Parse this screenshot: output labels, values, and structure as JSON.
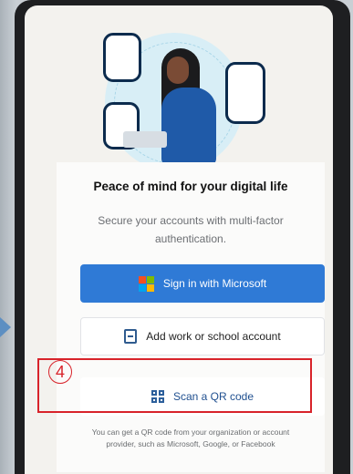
{
  "illustration": {
    "description": "",
    "accent_colors": [
      "#d8eef6",
      "#0c2b4d",
      "#1f5aa8",
      "#1b1b1d"
    ]
  },
  "panel": {
    "title": "Peace of mind for your digital life",
    "subtitle": "Secure your accounts with multi-factor authentication."
  },
  "buttons": {
    "sign_in_microsoft": "Sign in with Microsoft",
    "add_work_school": "Add work or school account",
    "scan_qr": "Scan a QR code"
  },
  "hint": "You can get a QR code from your organization or account provider, such as Microsoft, Google, or Facebook",
  "annotation": {
    "step_number": "4",
    "highlight_color": "#d8232a"
  },
  "colors": {
    "primary": "#2f7ad6",
    "link": "#1f4f8f",
    "text": "#111111"
  },
  "icons": {
    "microsoft_logo": "microsoft-logo-icon",
    "work_account": "work-account-icon",
    "qr_code": "qr-code-icon",
    "annotation_arrow": "arrow-right-icon"
  }
}
